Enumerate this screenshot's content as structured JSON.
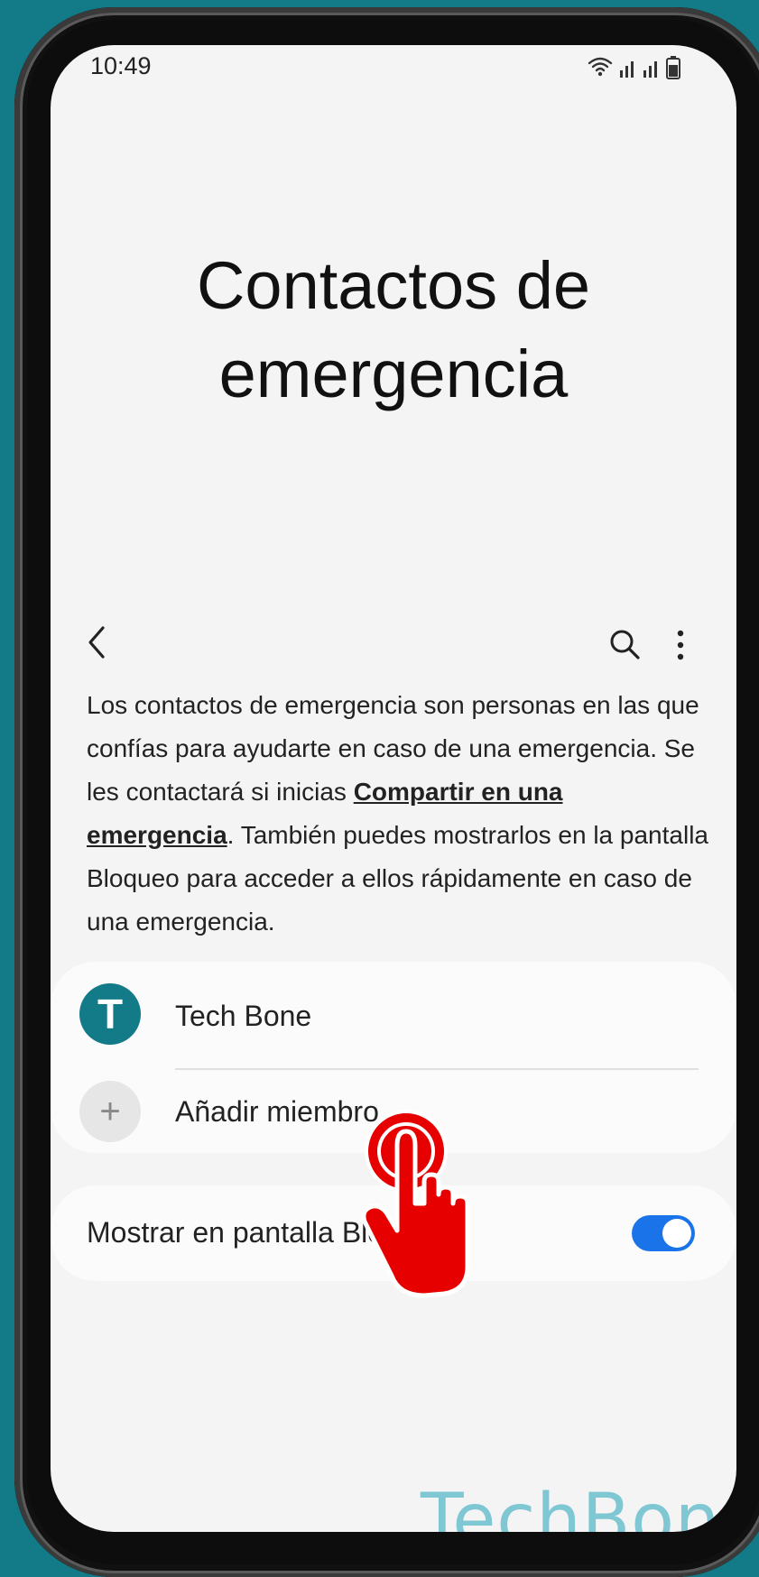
{
  "status_bar": {
    "time": "10:49",
    "icons": [
      "wifi-icon",
      "signal-icon",
      "signal-icon",
      "battery-icon"
    ]
  },
  "page": {
    "title_line1": "Contactos de",
    "title_line2": "emergencia"
  },
  "toolbar": {
    "back_icon": "back-arrow-icon",
    "search_icon": "search-icon",
    "more_icon": "more-vert-icon"
  },
  "description": {
    "part1": "Los contactos de emergencia son personas en las que confías para ayudarte en caso de una emergencia. Se les contactará si inicias ",
    "link": "Compartir en una emergencia",
    "part2": ". También puedes mostrarlos en la pantalla Bloqueo para acceder a ellos rápidamente en caso de una emergencia."
  },
  "contacts": {
    "items": [
      {
        "initial": "T",
        "name": "Tech Bone"
      }
    ],
    "add_label": "Añadir miembro",
    "add_icon": "+"
  },
  "lock_screen": {
    "label": "Mostrar en pantalla Bloqueo",
    "toggle_on": true
  },
  "colors": {
    "accent": "#1a73e8",
    "avatar": "#137a88",
    "background": "#137a88",
    "tap_hand": "#e60000"
  },
  "watermark": "TechBone"
}
